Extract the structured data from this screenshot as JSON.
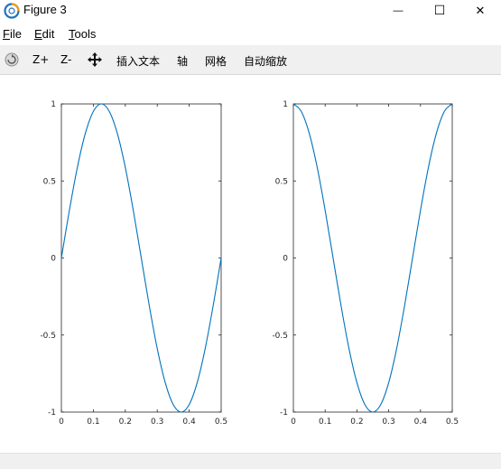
{
  "window": {
    "title": "Figure 3",
    "minimize_glyph": "—",
    "maximize_glyph": "☐",
    "close_glyph": "✕"
  },
  "menu": {
    "file": {
      "accel": "F",
      "rest": "ile"
    },
    "edit": {
      "accel": "E",
      "rest": "dit"
    },
    "tools": {
      "accel": "T",
      "rest": "ools"
    }
  },
  "toolbar": {
    "zoom_in": "Z+",
    "zoom_out": "Z-",
    "insert_text": "插入文本",
    "axis": "轴",
    "grid": "网格",
    "autoscale": "自动缩放"
  },
  "colors": {
    "line": "#0072bd",
    "axes": "#262626"
  },
  "chart_data": [
    {
      "type": "line",
      "title": "",
      "xlabel": "",
      "ylabel": "",
      "xlim": [
        0,
        0.5
      ],
      "ylim": [
        -1,
        1
      ],
      "x_ticks": [
        "0",
        "0.1",
        "0.2",
        "0.3",
        "0.4",
        "0.5"
      ],
      "y_ticks": [
        "1",
        "0.5",
        "0",
        "-0.5",
        "-1"
      ],
      "grid": false,
      "series": [
        {
          "x": [
            0,
            0.025,
            0.05,
            0.075,
            0.1,
            0.125,
            0.15,
            0.175,
            0.2,
            0.225,
            0.25,
            0.275,
            0.3,
            0.325,
            0.35,
            0.375,
            0.4,
            0.425,
            0.45,
            0.475,
            0.5
          ],
          "y": [
            0,
            0.309,
            0.588,
            0.809,
            0.951,
            1,
            0.951,
            0.809,
            0.588,
            0.309,
            0,
            -0.309,
            -0.588,
            -0.809,
            -0.951,
            -1,
            -0.951,
            -0.809,
            -0.588,
            -0.309,
            0
          ]
        }
      ]
    },
    {
      "type": "line",
      "title": "",
      "xlabel": "",
      "ylabel": "",
      "xlim": [
        0,
        0.5
      ],
      "ylim": [
        -1,
        1
      ],
      "x_ticks": [
        "0",
        "0.1",
        "0.2",
        "0.3",
        "0.4",
        "0.5"
      ],
      "y_ticks": [
        "1",
        "0.5",
        "0",
        "-0.5",
        "-1"
      ],
      "grid": false,
      "series": [
        {
          "x": [
            0,
            0.025,
            0.05,
            0.075,
            0.1,
            0.125,
            0.15,
            0.175,
            0.2,
            0.225,
            0.25,
            0.275,
            0.3,
            0.325,
            0.35,
            0.375,
            0.4,
            0.425,
            0.45,
            0.475,
            0.5
          ],
          "y": [
            1,
            0.951,
            0.809,
            0.588,
            0.309,
            0,
            -0.309,
            -0.588,
            -0.809,
            -0.951,
            -1,
            -0.951,
            -0.809,
            -0.588,
            -0.309,
            0,
            0.309,
            0.588,
            0.809,
            0.951,
            1
          ]
        }
      ]
    }
  ]
}
